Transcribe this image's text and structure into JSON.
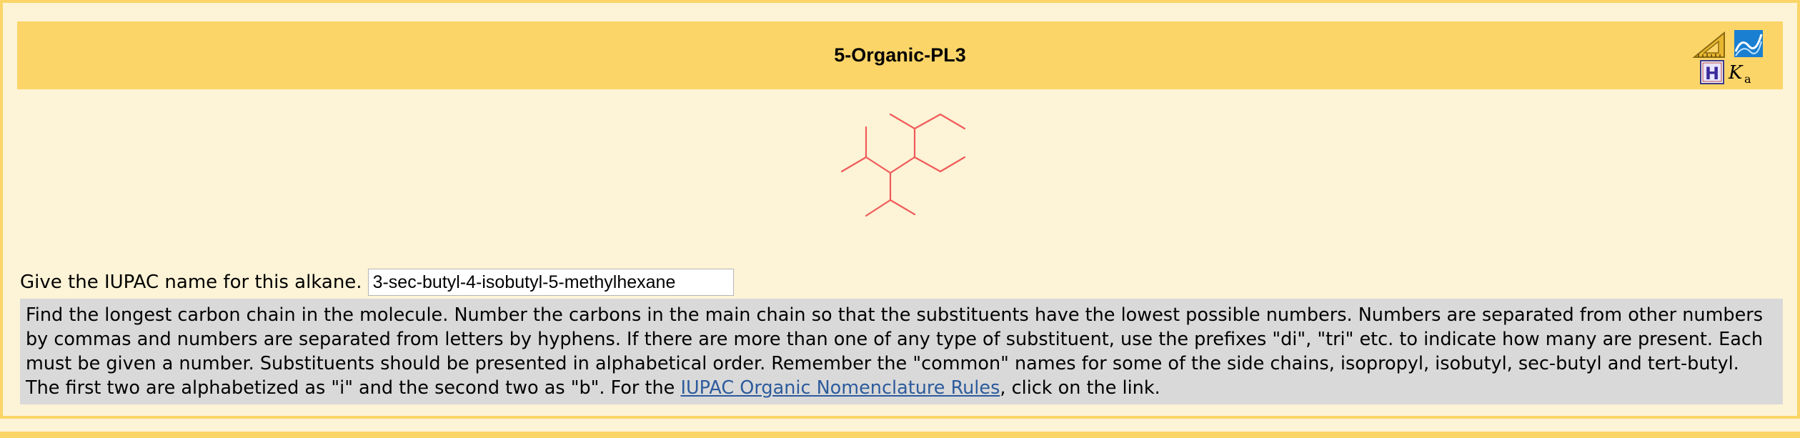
{
  "header": {
    "title": "5-Organic-PL3",
    "tools": [
      {
        "name": "ruler-icon"
      },
      {
        "name": "spectrum-icon"
      },
      {
        "name": "hydrogen-icon"
      },
      {
        "name": "ka-icon",
        "label": "K",
        "subscript": "a"
      }
    ]
  },
  "question": {
    "prompt": "Give the IUPAC name for this alkane.",
    "answer_value": "3-sec-butyl-4-isobutyl-5-methylhexane"
  },
  "hint": {
    "text_before_link": "Find the longest carbon chain in the molecule. Number the carbons in the main chain so that the substituents have the lowest possible numbers. Numbers are separated from other numbers by commas and numbers are separated from letters by hyphens. If there are more than one of any type of substituent, use the prefixes \"di\", \"tri\" etc. to indicate how many are present. Each must be given a number. Substituents should be presented in alphabetical order. Remember the \"common\" names for some of the side chains, isopropyl, isobutyl, sec-butyl and tert-butyl. The first two are alphabetized as \"i\" and the second two as \"b\". For the ",
    "link_text": "IUPAC Organic Nomenclature Rules",
    "text_after_link": ", click on the link."
  },
  "colors": {
    "header_bg": "#fcd568",
    "page_bg": "#fdf3d6",
    "hint_bg": "#d9d9d9",
    "bond": "#f05a5a",
    "link": "#2c5b9c"
  }
}
